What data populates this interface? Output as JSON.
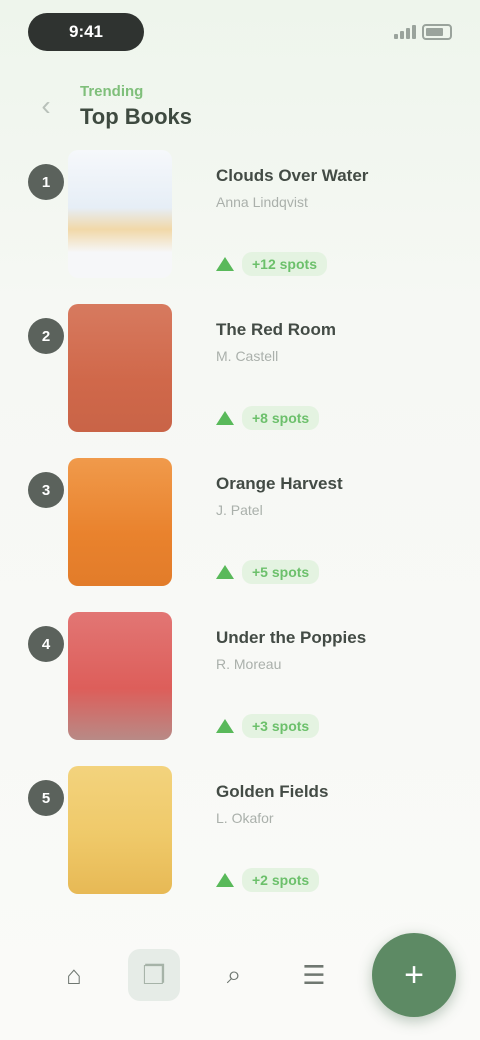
{
  "status_bar": {
    "time": "9:41"
  },
  "header": {
    "subtitle": "Trending",
    "title": "Top Books"
  },
  "books": [
    {
      "rank": "1",
      "title": "Clouds Over Water",
      "author": "Anna Lindqvist",
      "trend": "+12 spots",
      "cover_style": "c1"
    },
    {
      "rank": "2",
      "title": "The Red Room",
      "author": "M. Castell",
      "trend": "+8 spots",
      "cover_style": "c2"
    },
    {
      "rank": "3",
      "title": "Orange Harvest",
      "author": "J. Patel",
      "trend": "+5 spots",
      "cover_style": "c3"
    },
    {
      "rank": "4",
      "title": "Under the Poppies",
      "author": "R. Moreau",
      "trend": "+3 spots",
      "cover_style": "c4"
    },
    {
      "rank": "5",
      "title": "Golden Fields",
      "author": "L. Okafor",
      "trend": "+2 spots",
      "cover_style": "c5"
    }
  ],
  "tab_bar": {
    "tabs": [
      {
        "name": "home-icon",
        "glyph": "⌂"
      },
      {
        "name": "bookmark-icon",
        "glyph": "❐"
      },
      {
        "name": "search-icon",
        "glyph": "⌕"
      },
      {
        "name": "library-icon",
        "glyph": "☰"
      }
    ],
    "fab_glyph": "+"
  },
  "colors": {
    "accent": "#5d8a64",
    "trend_green": "#59b95a"
  }
}
